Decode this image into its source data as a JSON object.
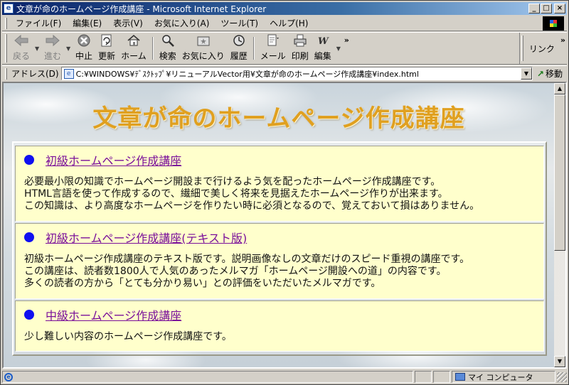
{
  "window": {
    "title": "文章が命のホームページ作成講座 - Microsoft Internet Explorer",
    "controls": {
      "minimize": "_",
      "maximize": "□",
      "close": "×"
    }
  },
  "menubar": {
    "items": [
      "ファイル(F)",
      "編集(E)",
      "表示(V)",
      "お気に入り(A)",
      "ツール(T)",
      "ヘルプ(H)"
    ]
  },
  "toolbar": {
    "back": "戻る",
    "forward": "進む",
    "stop": "中止",
    "refresh": "更新",
    "home": "ホーム",
    "search": "検索",
    "favorites": "お気に入り",
    "history": "履歴",
    "mail": "メール",
    "print": "印刷",
    "edit": "編集",
    "links": "リンク",
    "chevron": "»"
  },
  "addressbar": {
    "label": "アドレス(D)",
    "url": "C:¥WINDOWS¥ﾃﾞｽｸﾄｯﾌﾟ¥リニューアルVector用¥文章が命のホームページ作成講座¥index.html",
    "go": "移動"
  },
  "page": {
    "title": "文章が命のホームページ作成講座",
    "courses": [
      {
        "link": "初級ホームページ作成講座",
        "lines": [
          "必要最小限の知識でホームページ開設まで行けるよう気を配ったホームページ作成講座です。",
          "HTML言語を使って作成するので、繊細で美しく将来を見据えたホームページ作りが出来ます。",
          "この知識は、より高度なホームページを作りたい時に必須となるので、覚えておいて損はありません。"
        ]
      },
      {
        "link": "初級ホームページ作成講座(テキスト版)",
        "lines": [
          "初級ホームページ作成講座のテキスト版です。説明画像なしの文章だけのスピード重視の講座です。",
          "この講座は、読者数1800人で人気のあったメルマガ「ホームページ開設への道」の内容です。",
          "多くの読者の方から「とても分かり易い」との評価をいただいたメルマガです。"
        ]
      },
      {
        "link": "中級ホームページ作成講座",
        "lines": [
          "少し難しい内容のホームページ作成講座です。"
        ]
      }
    ]
  },
  "statusbar": {
    "zone": "マイ コンピュータ"
  },
  "colors": {
    "title_gold": "#e0a020",
    "link_visited": "#7a0f9a",
    "course_bg": "#ffffcc",
    "bullet": "#1010f0",
    "titlebar_start": "#0a246a",
    "titlebar_end": "#a6caf0"
  },
  "icons": [
    "ie-page-icon",
    "back-arrow-icon",
    "forward-arrow-icon",
    "stop-icon",
    "refresh-icon",
    "home-icon",
    "search-icon",
    "favorites-icon",
    "history-icon",
    "mail-icon",
    "print-icon",
    "edit-icon",
    "go-arrow-icon",
    "my-computer-icon",
    "windows-logo-icon"
  ]
}
